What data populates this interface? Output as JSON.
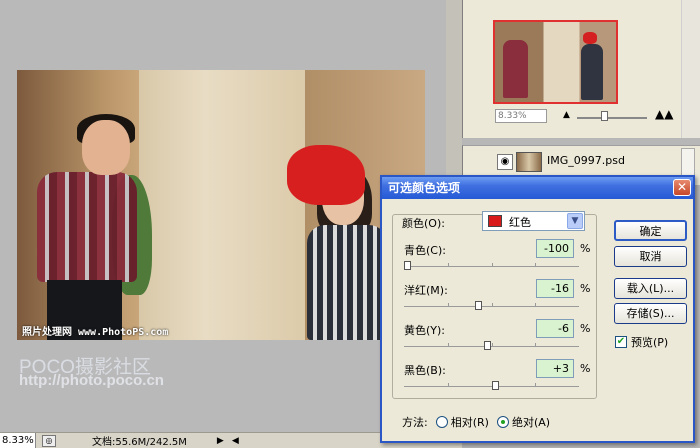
{
  "canvas": {
    "watermark": "照片处理网 www.PhotoPS.com",
    "poco_logo": "POCO摄影社区",
    "poco_url": "http://photo.poco.cn"
  },
  "statusbar": {
    "zoom": "8.33%",
    "doc": "文档:55.6M/242.5M",
    "arrow": "▶",
    "scroll_left": "◀"
  },
  "navigator": {
    "zoom": "8.33%",
    "small_mountain": "▲",
    "big_mountain": "▲▲"
  },
  "layers": {
    "eye": "👁",
    "name": "IMG_0997.psd"
  },
  "dialog": {
    "title": "可选颜色选项",
    "close": "✕",
    "color_label": "颜色(O):",
    "color_value": "红色",
    "color_swatch": "#d81a1a",
    "sliders": [
      {
        "label": "青色(C):",
        "value": "-100",
        "unit": "%",
        "fraction": 0.0
      },
      {
        "label": "洋红(M):",
        "value": "-16",
        "unit": "%",
        "fraction": 0.42
      },
      {
        "label": "黄色(Y):",
        "value": "-6",
        "unit": "%",
        "fraction": 0.47
      },
      {
        "label": "黑色(B):",
        "value": "+3",
        "unit": "%",
        "fraction": 0.515
      }
    ],
    "buttons": {
      "ok": "确定",
      "cancel": "取消",
      "load": "载入(L)...",
      "save": "存储(S)..."
    },
    "preview_label": "预览(P)",
    "preview_checked": true,
    "method_label": "方法:",
    "method_relative": "相对(R)",
    "method_absolute": "绝对(A)",
    "method_selected": "absolute"
  }
}
